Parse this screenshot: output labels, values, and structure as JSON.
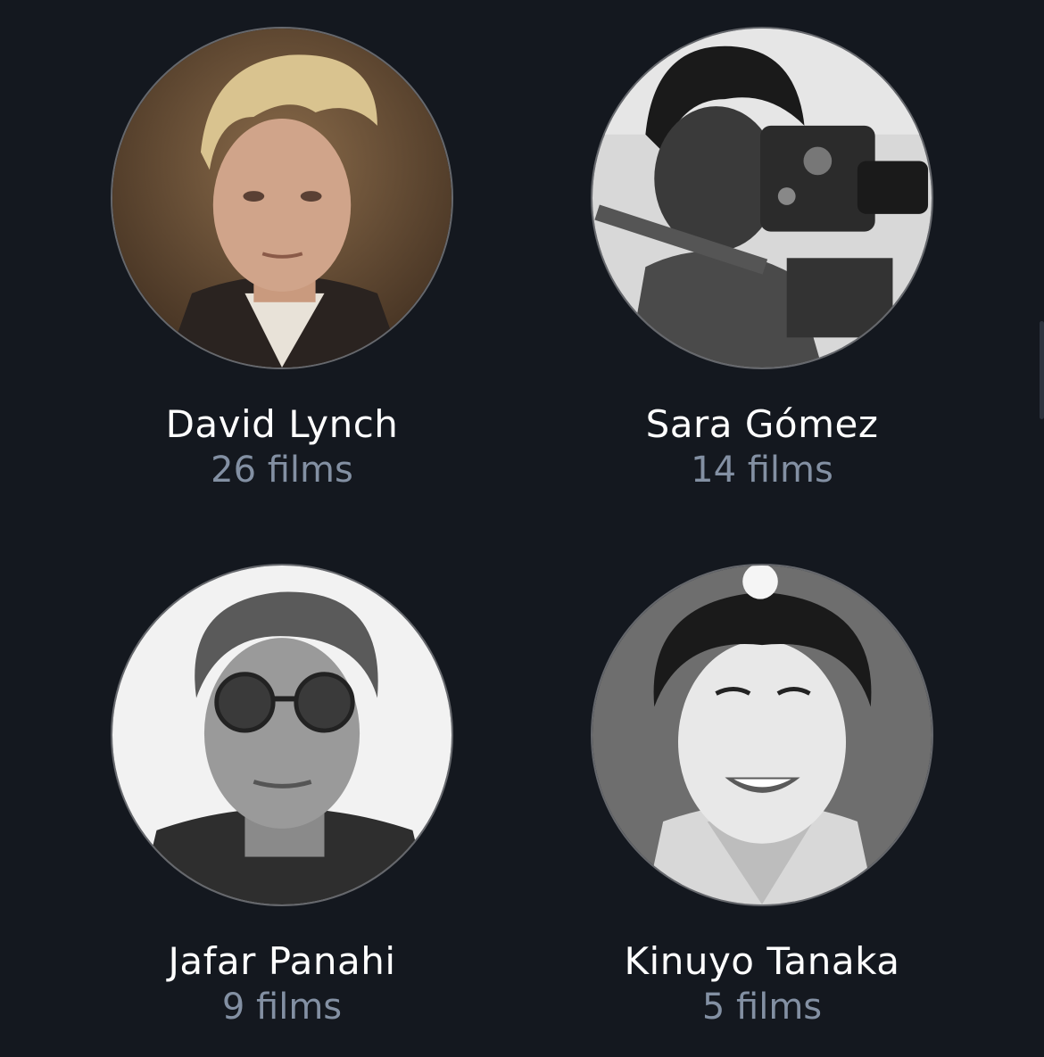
{
  "people": [
    {
      "name": "David Lynch",
      "count": "26 films",
      "photo": "portrait-photo-david-lynch"
    },
    {
      "name": "Sara Gómez",
      "count": "14 films",
      "photo": "portrait-photo-sara-gomez"
    },
    {
      "name": "Jafar Panahi",
      "count": "9 films",
      "photo": "portrait-photo-jafar-panahi"
    },
    {
      "name": "Kinuyo Tanaka",
      "count": "5 films",
      "photo": "portrait-photo-kinuyo-tanaka"
    }
  ],
  "colors": {
    "background": "#14181f",
    "name_text": "#ffffff",
    "count_text": "#8390a3"
  }
}
